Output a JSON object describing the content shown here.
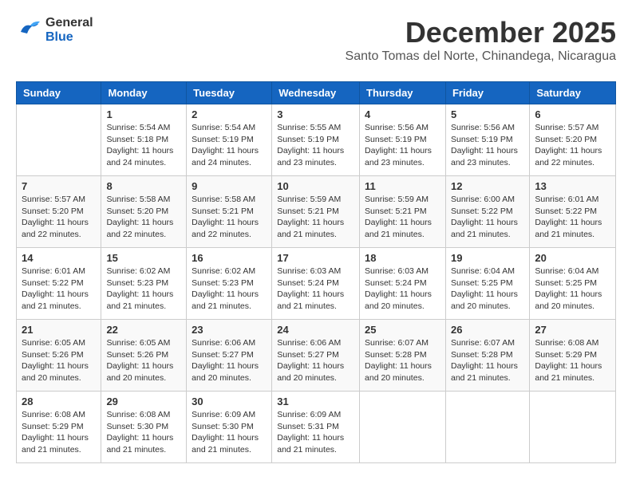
{
  "header": {
    "logo_general": "General",
    "logo_blue": "Blue",
    "month_year": "December 2025",
    "location": "Santo Tomas del Norte, Chinandega, Nicaragua"
  },
  "calendar": {
    "days_of_week": [
      "Sunday",
      "Monday",
      "Tuesday",
      "Wednesday",
      "Thursday",
      "Friday",
      "Saturday"
    ],
    "weeks": [
      [
        {
          "day": "",
          "info": ""
        },
        {
          "day": "1",
          "info": "Sunrise: 5:54 AM\nSunset: 5:18 PM\nDaylight: 11 hours\nand 24 minutes."
        },
        {
          "day": "2",
          "info": "Sunrise: 5:54 AM\nSunset: 5:19 PM\nDaylight: 11 hours\nand 24 minutes."
        },
        {
          "day": "3",
          "info": "Sunrise: 5:55 AM\nSunset: 5:19 PM\nDaylight: 11 hours\nand 23 minutes."
        },
        {
          "day": "4",
          "info": "Sunrise: 5:56 AM\nSunset: 5:19 PM\nDaylight: 11 hours\nand 23 minutes."
        },
        {
          "day": "5",
          "info": "Sunrise: 5:56 AM\nSunset: 5:19 PM\nDaylight: 11 hours\nand 23 minutes."
        },
        {
          "day": "6",
          "info": "Sunrise: 5:57 AM\nSunset: 5:20 PM\nDaylight: 11 hours\nand 22 minutes."
        }
      ],
      [
        {
          "day": "7",
          "info": "Sunrise: 5:57 AM\nSunset: 5:20 PM\nDaylight: 11 hours\nand 22 minutes."
        },
        {
          "day": "8",
          "info": "Sunrise: 5:58 AM\nSunset: 5:20 PM\nDaylight: 11 hours\nand 22 minutes."
        },
        {
          "day": "9",
          "info": "Sunrise: 5:58 AM\nSunset: 5:21 PM\nDaylight: 11 hours\nand 22 minutes."
        },
        {
          "day": "10",
          "info": "Sunrise: 5:59 AM\nSunset: 5:21 PM\nDaylight: 11 hours\nand 21 minutes."
        },
        {
          "day": "11",
          "info": "Sunrise: 5:59 AM\nSunset: 5:21 PM\nDaylight: 11 hours\nand 21 minutes."
        },
        {
          "day": "12",
          "info": "Sunrise: 6:00 AM\nSunset: 5:22 PM\nDaylight: 11 hours\nand 21 minutes."
        },
        {
          "day": "13",
          "info": "Sunrise: 6:01 AM\nSunset: 5:22 PM\nDaylight: 11 hours\nand 21 minutes."
        }
      ],
      [
        {
          "day": "14",
          "info": "Sunrise: 6:01 AM\nSunset: 5:22 PM\nDaylight: 11 hours\nand 21 minutes."
        },
        {
          "day": "15",
          "info": "Sunrise: 6:02 AM\nSunset: 5:23 PM\nDaylight: 11 hours\nand 21 minutes."
        },
        {
          "day": "16",
          "info": "Sunrise: 6:02 AM\nSunset: 5:23 PM\nDaylight: 11 hours\nand 21 minutes."
        },
        {
          "day": "17",
          "info": "Sunrise: 6:03 AM\nSunset: 5:24 PM\nDaylight: 11 hours\nand 21 minutes."
        },
        {
          "day": "18",
          "info": "Sunrise: 6:03 AM\nSunset: 5:24 PM\nDaylight: 11 hours\nand 20 minutes."
        },
        {
          "day": "19",
          "info": "Sunrise: 6:04 AM\nSunset: 5:25 PM\nDaylight: 11 hours\nand 20 minutes."
        },
        {
          "day": "20",
          "info": "Sunrise: 6:04 AM\nSunset: 5:25 PM\nDaylight: 11 hours\nand 20 minutes."
        }
      ],
      [
        {
          "day": "21",
          "info": "Sunrise: 6:05 AM\nSunset: 5:26 PM\nDaylight: 11 hours\nand 20 minutes."
        },
        {
          "day": "22",
          "info": "Sunrise: 6:05 AM\nSunset: 5:26 PM\nDaylight: 11 hours\nand 20 minutes."
        },
        {
          "day": "23",
          "info": "Sunrise: 6:06 AM\nSunset: 5:27 PM\nDaylight: 11 hours\nand 20 minutes."
        },
        {
          "day": "24",
          "info": "Sunrise: 6:06 AM\nSunset: 5:27 PM\nDaylight: 11 hours\nand 20 minutes."
        },
        {
          "day": "25",
          "info": "Sunrise: 6:07 AM\nSunset: 5:28 PM\nDaylight: 11 hours\nand 20 minutes."
        },
        {
          "day": "26",
          "info": "Sunrise: 6:07 AM\nSunset: 5:28 PM\nDaylight: 11 hours\nand 21 minutes."
        },
        {
          "day": "27",
          "info": "Sunrise: 6:08 AM\nSunset: 5:29 PM\nDaylight: 11 hours\nand 21 minutes."
        }
      ],
      [
        {
          "day": "28",
          "info": "Sunrise: 6:08 AM\nSunset: 5:29 PM\nDaylight: 11 hours\nand 21 minutes."
        },
        {
          "day": "29",
          "info": "Sunrise: 6:08 AM\nSunset: 5:30 PM\nDaylight: 11 hours\nand 21 minutes."
        },
        {
          "day": "30",
          "info": "Sunrise: 6:09 AM\nSunset: 5:30 PM\nDaylight: 11 hours\nand 21 minutes."
        },
        {
          "day": "31",
          "info": "Sunrise: 6:09 AM\nSunset: 5:31 PM\nDaylight: 11 hours\nand 21 minutes."
        },
        {
          "day": "",
          "info": ""
        },
        {
          "day": "",
          "info": ""
        },
        {
          "day": "",
          "info": ""
        }
      ]
    ]
  }
}
